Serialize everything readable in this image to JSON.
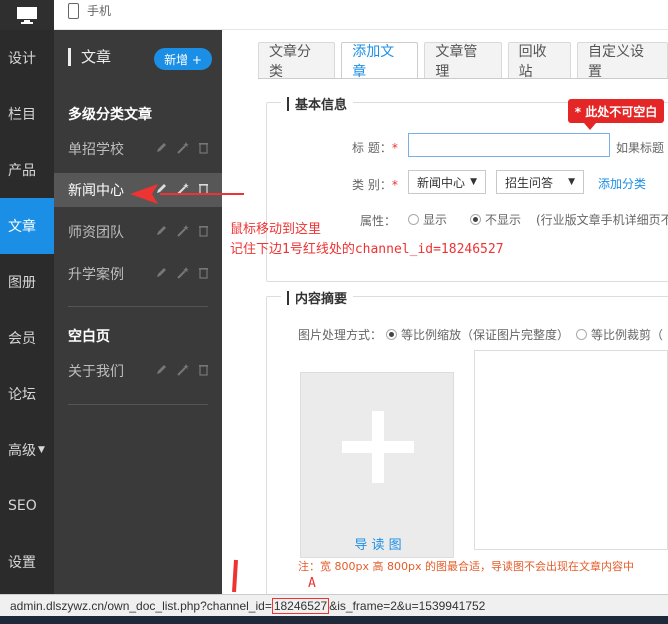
{
  "topbar": {
    "phone_label": "手机"
  },
  "leftnav": [
    {
      "label": "设计",
      "active": false
    },
    {
      "label": "栏目",
      "active": false
    },
    {
      "label": "产品",
      "active": false
    },
    {
      "label": "文章",
      "active": true
    },
    {
      "label": "图册",
      "active": false
    },
    {
      "label": "会员",
      "active": false
    },
    {
      "label": "论坛",
      "active": false
    },
    {
      "label": "高级",
      "active": false
    },
    {
      "label": "SEO",
      "active": false
    },
    {
      "label": "设置",
      "active": false
    }
  ],
  "subnav": {
    "title": "文章",
    "new_button": "新增 +",
    "group1_title": "多级分类文章",
    "group1_items": [
      "单招学校",
      "新闻中心",
      "师资团队",
      "升学案例"
    ],
    "group2_title": "空白页",
    "group2_items": [
      "关于我们"
    ]
  },
  "tabs": [
    "文章分类",
    "添加文章",
    "文章管理",
    "回收站",
    "自定义设置"
  ],
  "form": {
    "section1_title": "基本信息",
    "title_label": "标 题：",
    "required_mark": "*",
    "title_hint": "如果标题",
    "category_label": "类 别：",
    "category_value1": "新闻中心",
    "category_value2": "招生问答",
    "add_category_link": "添加分类",
    "attr_label": "属性：",
    "attr_option1": "显示",
    "attr_option2": "不显示",
    "attr_note": "(行业版文章手机详细页不",
    "tooltip": "* 此处不可空白",
    "section2_title": "内容摘要",
    "image_mode_label": "图片处理方式：",
    "image_mode_option1": "等比例缩放（保证图片完整度）",
    "image_mode_option2": "等比例裁剪（",
    "image_caption": "导 读 图",
    "image_note": "注：宽 800px 高 800px 的图最合适，导读图不会出现在文章内容中"
  },
  "annotation": {
    "line1": "鼠标移动到这里",
    "line2": "记住下边1号红线处的channel_id=18246527",
    "marker": "A"
  },
  "statusbar": {
    "url_prefix": "admin.dlszywz.cn/own_doc_list.php?channel_id=",
    "channel_id": "18246527",
    "url_suffix": "&is_frame=2&u=1539941752"
  }
}
